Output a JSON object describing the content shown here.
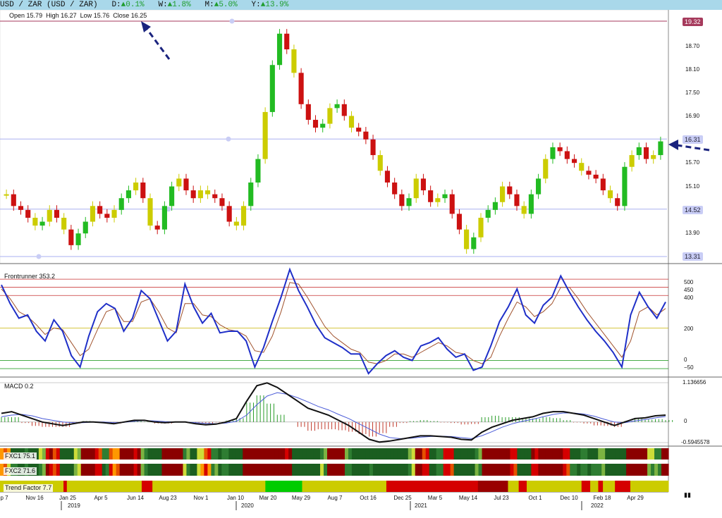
{
  "header": {
    "symbol": "USD / ZAR (USD / ZAR)",
    "changes": [
      {
        "label": "D:",
        "arrow": "▲",
        "value": "0.1%"
      },
      {
        "label": "W:",
        "arrow": "▲",
        "value": "1.8%"
      },
      {
        "label": "M:",
        "arrow": "▲",
        "value": "5.0%"
      },
      {
        "label": "Y:",
        "arrow": "▲",
        "value": "13.9%"
      }
    ]
  },
  "ohlc": {
    "open_label": "Open",
    "open": "15.79",
    "high_label": "High",
    "high": "16.27",
    "low_label": "Low",
    "low": "15.76",
    "close_label": "Close",
    "close": "16.25"
  },
  "price_axis": {
    "ticks": [
      "18.70",
      "18.10",
      "17.50",
      "16.90",
      "15.70",
      "15.10",
      "13.90"
    ]
  },
  "levels": [
    {
      "value": "19.32",
      "color": "#a63a5c"
    },
    {
      "value": "16.31",
      "color": "#c9cdf5"
    },
    {
      "value": "14.52",
      "color": "#c9cdf5"
    },
    {
      "value": "13.31",
      "color": "#c9cdf5"
    }
  ],
  "frontrunner": {
    "title": "Frontrunner 353.2",
    "levels": [
      "500",
      "450",
      "400",
      "200",
      "0",
      "−50"
    ]
  },
  "macd": {
    "title": "MACD 0.2",
    "max": "1.136656",
    "zero": "0",
    "min": "-0.5945578"
  },
  "fxc1": {
    "title": "FXC1 75.1"
  },
  "fxc2": {
    "title": "FXC2 71.6"
  },
  "trend": {
    "title": "Trend Factor 7.7"
  },
  "x_axis": {
    "months": [
      "p 7",
      "Nov 16",
      "Jan 25",
      "Apr 5",
      "Jun 14",
      "Aug 23",
      "Nov 1",
      "Jan 10",
      "Mar 20",
      "May 29",
      "Aug 7",
      "Oct 16",
      "Dec 25",
      "Mar 5",
      "May 14",
      "Jul 23",
      "Oct 1",
      "Dec 10",
      "Feb 18",
      "Apr 29"
    ],
    "years": [
      "2019",
      "2020",
      "2021",
      "2022"
    ]
  },
  "corner_icon": "pause-icon",
  "chart_data": {
    "type": "candlestick",
    "title": "USD / ZAR (USD / ZAR)",
    "y_range": [
      13.2,
      19.4
    ],
    "key_levels": [
      19.32,
      16.31,
      14.52,
      13.31
    ],
    "close_path": [
      14.9,
      14.6,
      14.5,
      14.3,
      14.1,
      14.2,
      14.5,
      14.3,
      14.0,
      13.6,
      13.9,
      14.2,
      14.6,
      14.4,
      14.3,
      14.5,
      14.8,
      15.0,
      15.2,
      14.8,
      14.1,
      14.0,
      14.6,
      15.1,
      15.3,
      15.0,
      14.8,
      15.0,
      14.9,
      14.8,
      14.6,
      14.2,
      14.1,
      14.6,
      15.2,
      15.8,
      17.0,
      18.2,
      19.0,
      18.6,
      18.0,
      17.2,
      16.8,
      16.6,
      16.7,
      17.1,
      17.2,
      16.9,
      16.6,
      16.5,
      16.3,
      15.9,
      15.5,
      15.2,
      14.9,
      14.6,
      14.8,
      15.3,
      15.0,
      14.7,
      14.8,
      14.9,
      14.4,
      14.0,
      13.5,
      13.8,
      14.3,
      14.5,
      14.7,
      15.1,
      14.9,
      14.6,
      14.4,
      14.9,
      15.3,
      15.8,
      16.1,
      16.0,
      15.8,
      15.7,
      15.5,
      15.4,
      15.3,
      15.0,
      14.8,
      14.6,
      15.6,
      15.9,
      16.1,
      15.8,
      15.9,
      16.25
    ],
    "frontrunner": {
      "fast": [
        465,
        350,
        260,
        280,
        180,
        120,
        250,
        180,
        30,
        -40,
        150,
        300,
        350,
        320,
        180,
        260,
        430,
        380,
        250,
        120,
        180,
        470,
        330,
        230,
        290,
        170,
        180,
        180,
        120,
        -40,
        80,
        240,
        390,
        560,
        430,
        330,
        220,
        140,
        110,
        80,
        40,
        40,
        -80,
        -20,
        30,
        60,
        20,
        0,
        90,
        110,
        140,
        70,
        20,
        40,
        -60,
        -40,
        90,
        240,
        330,
        440,
        280,
        230,
        340,
        390,
        520,
        420,
        330,
        250,
        180,
        120,
        50,
        -40,
        280,
        420,
        330,
        260,
        360
      ],
      "slow": [
        440,
        380,
        300,
        270,
        220,
        160,
        200,
        190,
        110,
        30,
        70,
        190,
        300,
        320,
        240,
        240,
        360,
        380,
        300,
        200,
        170,
        350,
        350,
        280,
        270,
        220,
        190,
        180,
        150,
        60,
        50,
        150,
        300,
        480,
        470,
        390,
        300,
        210,
        150,
        110,
        70,
        50,
        -10,
        -20,
        0,
        40,
        40,
        20,
        50,
        80,
        110,
        90,
        50,
        40,
        0,
        -20,
        20,
        150,
        260,
        360,
        330,
        270,
        300,
        350,
        450,
        450,
        380,
        300,
        230,
        160,
        90,
        20,
        120,
        300,
        330,
        280,
        320
      ],
      "levels": [
        500,
        450,
        400,
        200,
        0,
        -50
      ],
      "y_range": [
        -80,
        570
      ]
    },
    "macd": {
      "macd": [
        0.25,
        0.3,
        0.2,
        0.1,
        0.0,
        -0.05,
        -0.1,
        -0.05,
        0.0,
        0.0,
        -0.02,
        -0.05,
        0.0,
        0.05,
        0.05,
        0.0,
        -0.02,
        0.0,
        0.0,
        -0.05,
        -0.08,
        -0.06,
        0.0,
        0.1,
        0.6,
        1.05,
        1.13,
        1.0,
        0.8,
        0.6,
        0.4,
        0.3,
        0.2,
        0.05,
        -0.1,
        -0.3,
        -0.5,
        -0.58,
        -0.55,
        -0.5,
        -0.45,
        -0.4,
        -0.4,
        -0.42,
        -0.44,
        -0.5,
        -0.52,
        -0.3,
        -0.15,
        -0.05,
        0.05,
        0.1,
        0.15,
        0.25,
        0.3,
        0.3,
        0.25,
        0.2,
        0.1,
        0.0,
        -0.1,
        0.0,
        0.1,
        0.12,
        0.18,
        0.2
      ],
      "signal": [
        0.15,
        0.2,
        0.22,
        0.18,
        0.1,
        0.05,
        0.0,
        -0.02,
        -0.02,
        0.0,
        0.0,
        -0.02,
        -0.01,
        0.02,
        0.04,
        0.03,
        0.01,
        0.0,
        0.0,
        -0.02,
        -0.04,
        -0.05,
        -0.03,
        0.02,
        0.2,
        0.5,
        0.75,
        0.85,
        0.8,
        0.7,
        0.58,
        0.45,
        0.35,
        0.22,
        0.1,
        -0.05,
        -0.2,
        -0.35,
        -0.45,
        -0.48,
        -0.47,
        -0.44,
        -0.42,
        -0.41,
        -0.42,
        -0.45,
        -0.48,
        -0.4,
        -0.28,
        -0.15,
        -0.05,
        0.02,
        0.08,
        0.15,
        0.22,
        0.26,
        0.26,
        0.23,
        0.17,
        0.08,
        0.0,
        -0.02,
        0.03,
        0.07,
        0.12,
        0.16
      ],
      "y_range": [
        -0.5945578,
        1.136656
      ]
    },
    "trend_factor_segments": [
      {
        "color": "#cccc00",
        "span": [
          0,
          0.095
        ]
      },
      {
        "color": "#d50000",
        "span": [
          0.095,
          0.1
        ]
      },
      {
        "color": "#cccc00",
        "span": [
          0.1,
          0.212
        ]
      },
      {
        "color": "#d50000",
        "span": [
          0.212,
          0.228
        ]
      },
      {
        "color": "#cccc00",
        "span": [
          0.228,
          0.397
        ]
      },
      {
        "color": "#00cc00",
        "span": [
          0.397,
          0.452
        ]
      },
      {
        "color": "#cccc00",
        "span": [
          0.452,
          0.578
        ]
      },
      {
        "color": "#d50000",
        "span": [
          0.578,
          0.715
        ]
      },
      {
        "color": "#990000",
        "span": [
          0.715,
          0.76
        ]
      },
      {
        "color": "#cccc00",
        "span": [
          0.76,
          0.776
        ]
      },
      {
        "color": "#d50000",
        "span": [
          0.776,
          0.788
        ]
      },
      {
        "color": "#cccc00",
        "span": [
          0.788,
          0.87
        ]
      },
      {
        "color": "#d50000",
        "span": [
          0.87,
          0.883
        ]
      },
      {
        "color": "#cccc00",
        "span": [
          0.883,
          0.895
        ]
      },
      {
        "color": "#d50000",
        "span": [
          0.895,
          0.902
        ]
      },
      {
        "color": "#cccc00",
        "span": [
          0.902,
          0.92
        ]
      },
      {
        "color": "#d50000",
        "span": [
          0.92,
          0.943
        ]
      },
      {
        "color": "#cccc00",
        "span": [
          0.943,
          1.0
        ]
      }
    ]
  }
}
